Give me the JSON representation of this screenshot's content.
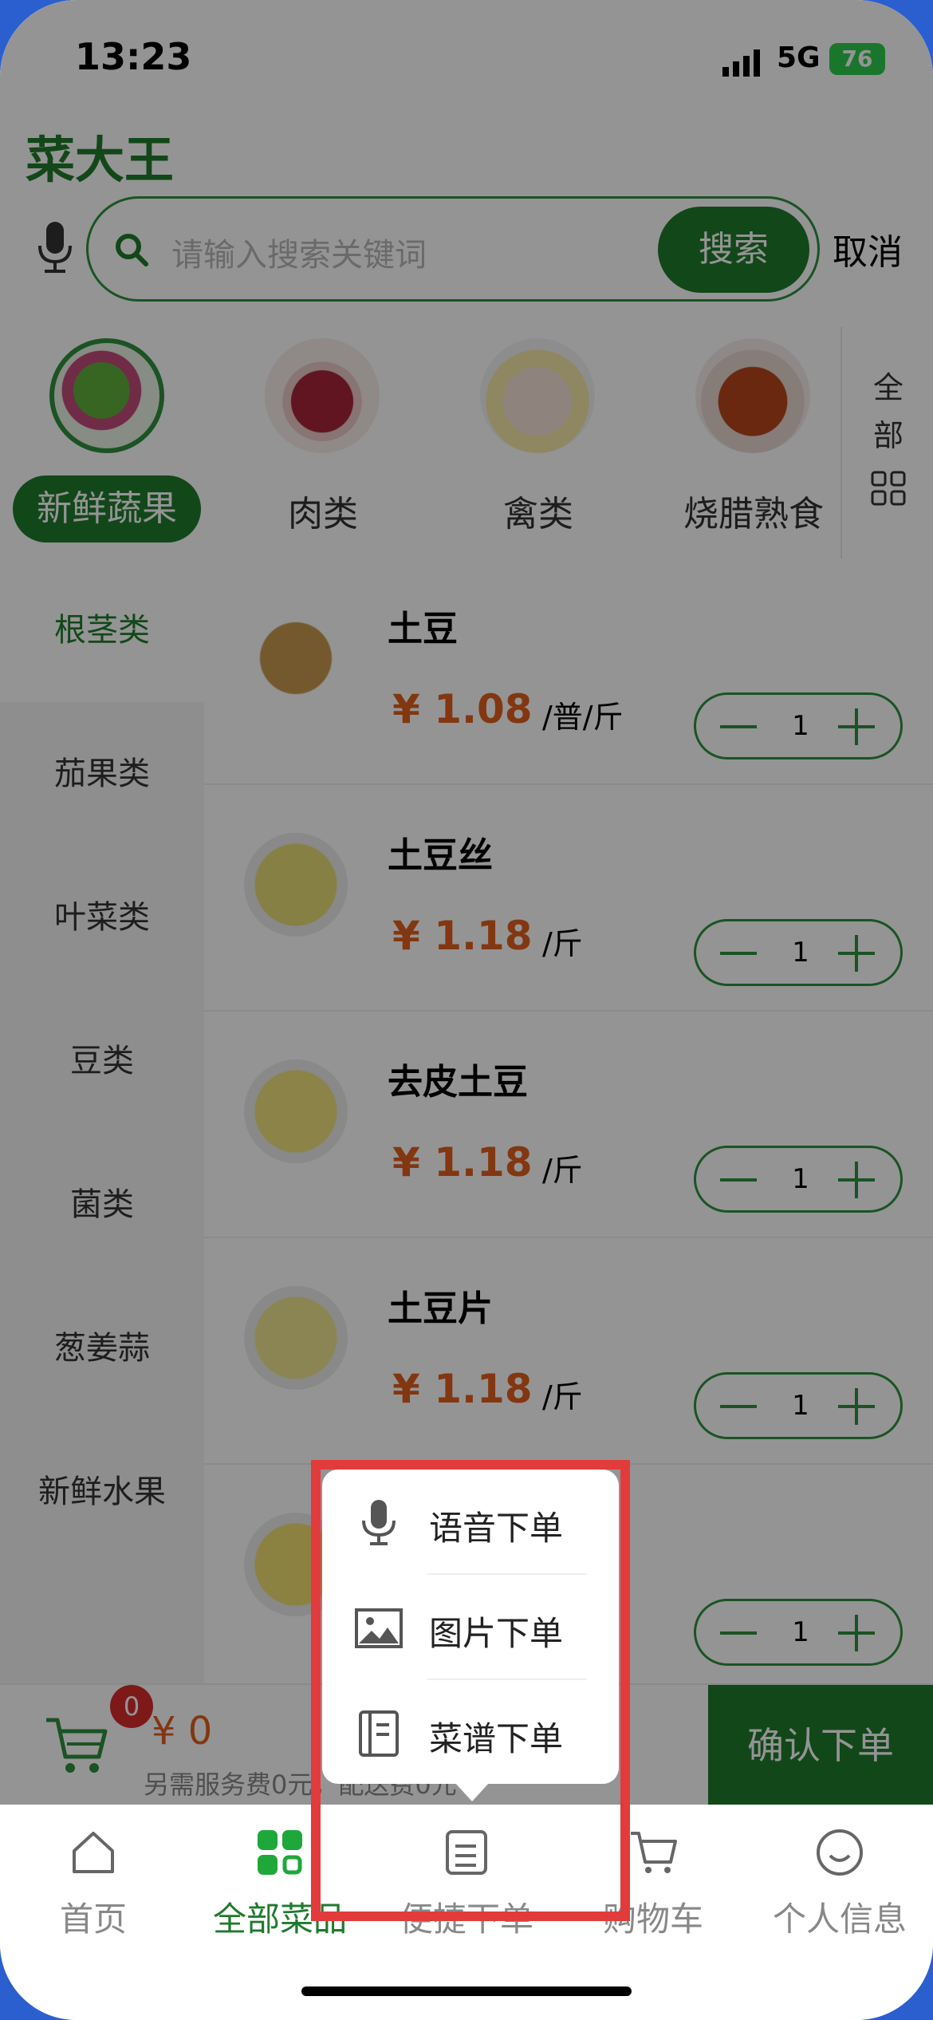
{
  "status_bar": {
    "time": "13:23",
    "network": "5G",
    "battery": "76"
  },
  "app": {
    "brand": "菜大王"
  },
  "search": {
    "placeholder": "请输入搜索关键词",
    "button": "搜索",
    "cancel": "取消"
  },
  "categories": [
    {
      "label": "新鲜蔬果",
      "active": true
    },
    {
      "label": "肉类",
      "active": false
    },
    {
      "label": "禽类",
      "active": false
    },
    {
      "label": "烧腊熟食",
      "active": false
    }
  ],
  "all_categories": {
    "line1": "全",
    "line2": "部"
  },
  "sidebar": [
    {
      "label": "根茎类",
      "active": true
    },
    {
      "label": "茄果类"
    },
    {
      "label": "叶菜类"
    },
    {
      "label": "豆类"
    },
    {
      "label": "菌类"
    },
    {
      "label": "葱姜蒜"
    },
    {
      "label": "新鲜水果"
    }
  ],
  "products": [
    {
      "name": "土豆",
      "price": "¥ 1.08",
      "unit": "/普/斤",
      "qty": "1"
    },
    {
      "name": "土豆丝",
      "price": "¥ 1.18",
      "unit": "/斤",
      "qty": "1"
    },
    {
      "name": "去皮土豆",
      "price": "¥ 1.18",
      "unit": "/斤",
      "qty": "1"
    },
    {
      "name": "土豆片",
      "price": "¥ 1.18",
      "unit": "/斤",
      "qty": "1"
    },
    {
      "name": "",
      "price": "",
      "unit": "",
      "qty": "1"
    }
  ],
  "cart": {
    "badge": "0",
    "total": "¥ 0",
    "fee_note": "另需服务费0元，配送费0元",
    "confirm": "确认下单"
  },
  "popup": {
    "items": [
      {
        "label": "语音下单",
        "icon": "microphone-icon"
      },
      {
        "label": "图片下单",
        "icon": "image-icon"
      },
      {
        "label": "菜谱下单",
        "icon": "recipe-book-icon"
      }
    ]
  },
  "tabs": [
    {
      "label": "首页",
      "icon": "home-icon"
    },
    {
      "label": "全部菜品",
      "icon": "grid-icon",
      "active": true
    },
    {
      "label": "便捷下单",
      "icon": "order-note-icon"
    },
    {
      "label": "购物车",
      "icon": "cart-icon"
    },
    {
      "label": "个人信息",
      "icon": "smile-icon"
    }
  ],
  "colors": {
    "accent": "#1f7a2e",
    "price": "#e0601e",
    "highlight": "#e23b3b",
    "badge": "#d92b2b"
  }
}
